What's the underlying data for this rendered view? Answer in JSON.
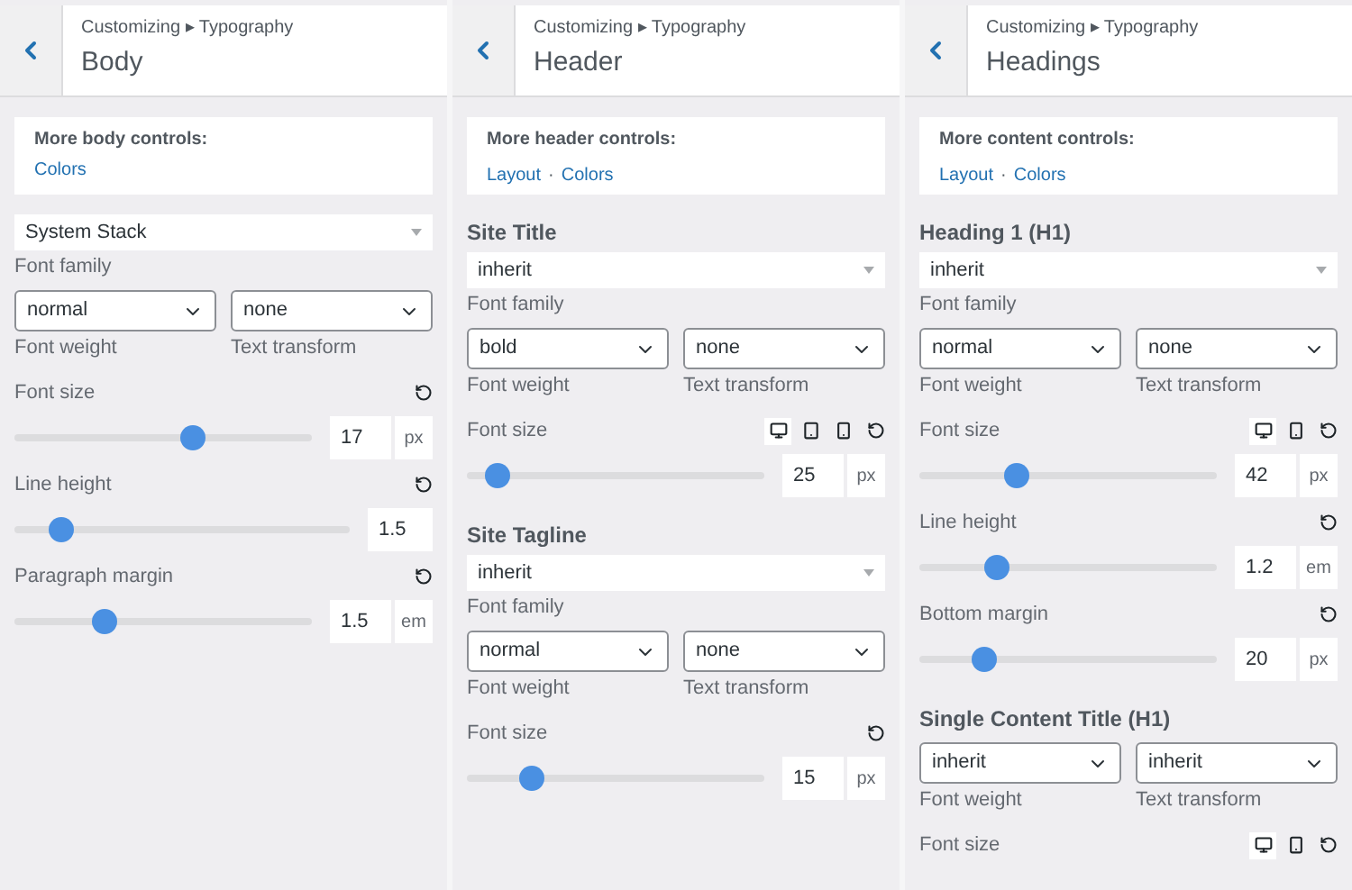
{
  "panels": [
    {
      "breadcrumb": "Customizing ▸ Typography",
      "title": "Body",
      "more": {
        "label": "More body controls:",
        "links": [
          "Colors"
        ]
      },
      "controls": [
        {
          "kind": "family",
          "value": "System Stack",
          "label": "Font family"
        },
        {
          "kind": "pair",
          "left": {
            "value": "normal",
            "label": "Font weight"
          },
          "right": {
            "value": "none",
            "label": "Text transform"
          }
        },
        {
          "kind": "slider",
          "label": "Font size",
          "level": 0.6,
          "value": "17",
          "unit": "px"
        },
        {
          "kind": "slider",
          "label": "Line height",
          "level": 0.14,
          "value": "1.5"
        },
        {
          "kind": "slider",
          "label": "Paragraph margin",
          "level": 0.3,
          "value": "1.5",
          "unit": "em"
        }
      ]
    },
    {
      "breadcrumb": "Customizing ▸ Typography",
      "title": "Header",
      "more": {
        "label": "More header controls:",
        "links": [
          "Layout",
          "Colors"
        ],
        "separator": "·"
      },
      "controls": [
        {
          "kind": "heading",
          "text": "Site Title"
        },
        {
          "kind": "family",
          "value": "inherit",
          "label": "Font family"
        },
        {
          "kind": "pair",
          "left": {
            "value": "bold",
            "label": "Font weight"
          },
          "right": {
            "value": "none",
            "label": "Text transform"
          }
        },
        {
          "kind": "slider",
          "label": "Font size",
          "devices": [
            {
              "kind": "desktop",
              "selected": true
            },
            {
              "kind": "tablet",
              "selected": false
            },
            {
              "kind": "mobile",
              "selected": false
            }
          ],
          "level": 0.1,
          "value": "25",
          "unit": "px"
        },
        {
          "kind": "heading",
          "text": "Site Tagline"
        },
        {
          "kind": "family",
          "value": "inherit",
          "label": "Font family"
        },
        {
          "kind": "pair",
          "left": {
            "value": "normal",
            "label": "Font weight"
          },
          "right": {
            "value": "none",
            "label": "Text transform"
          }
        },
        {
          "kind": "slider",
          "label": "Font size",
          "level": 0.22,
          "value": "15",
          "unit": "px"
        }
      ]
    },
    {
      "breadcrumb": "Customizing ▸ Typography",
      "title": "Headings",
      "more": {
        "label": "More content controls:",
        "links": [
          "Layout",
          "Colors"
        ],
        "separator": "·"
      },
      "controls": [
        {
          "kind": "heading",
          "text": "Heading 1 (H1)"
        },
        {
          "kind": "family",
          "value": "inherit",
          "label": "Font family"
        },
        {
          "kind": "pair",
          "left": {
            "value": "normal",
            "label": "Font weight"
          },
          "right": {
            "value": "none",
            "label": "Text transform"
          }
        },
        {
          "kind": "slider",
          "label": "Font size",
          "devices": [
            {
              "kind": "desktop",
              "selected": true
            },
            {
              "kind": "mobile",
              "selected": false
            }
          ],
          "level": 0.33,
          "value": "42",
          "unit": "px"
        },
        {
          "kind": "slider",
          "label": "Line height",
          "level": 0.26,
          "value": "1.2",
          "unit": "em"
        },
        {
          "kind": "slider",
          "label": "Bottom margin",
          "level": 0.22,
          "value": "20",
          "unit": "px"
        },
        {
          "kind": "heading",
          "text": "Single Content Title (H1)"
        },
        {
          "kind": "pair",
          "left": {
            "value": "inherit",
            "label": "Font weight"
          },
          "right": {
            "value": "inherit",
            "label": "Text transform"
          }
        },
        {
          "kind": "slider",
          "label": "Font size",
          "devices": [
            {
              "kind": "desktop",
              "selected": true
            },
            {
              "kind": "mobile",
              "selected": false
            }
          ]
        }
      ]
    }
  ]
}
